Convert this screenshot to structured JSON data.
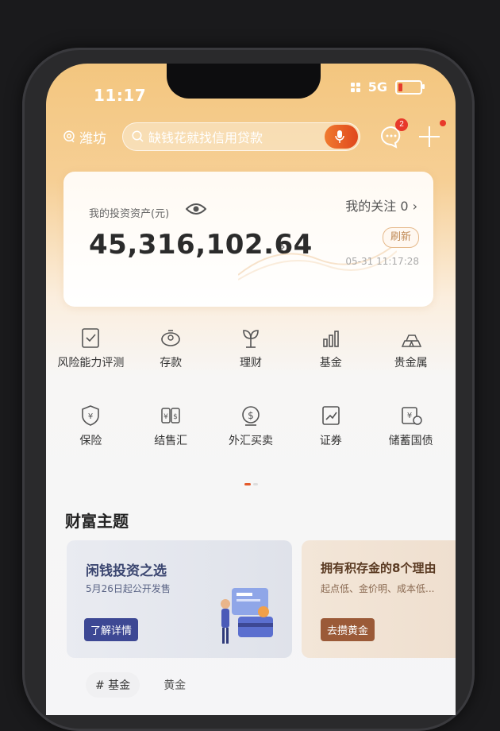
{
  "status": {
    "time": "11:17",
    "network": "5G"
  },
  "topbar": {
    "city": "潍坊",
    "search_placeholder": "缺钱花就找信用贷款",
    "message_badge": "2"
  },
  "asset": {
    "label": "我的投资资产(元)",
    "value": "45,316,102.64",
    "follow": "我的关注 0",
    "refresh": "刷新",
    "timestamp": "05-31 11:17:28"
  },
  "menu": {
    "row1": [
      {
        "label": "风险能力评测",
        "icon": "clipboard-check-icon"
      },
      {
        "label": "存款",
        "icon": "piggy-bank-icon"
      },
      {
        "label": "理财",
        "icon": "money-plant-icon"
      },
      {
        "label": "基金",
        "icon": "bar-chart-icon"
      },
      {
        "label": "贵金属",
        "icon": "gold-bars-icon"
      }
    ],
    "row2": [
      {
        "label": "保险",
        "icon": "shield-yen-icon"
      },
      {
        "label": "结售汇",
        "icon": "exchange-icon"
      },
      {
        "label": "外汇买卖",
        "icon": "currency-coin-icon"
      },
      {
        "label": "证券",
        "icon": "stock-chart-icon"
      },
      {
        "label": "储蓄国债",
        "icon": "bond-certificate-icon"
      }
    ]
  },
  "wealth": {
    "title": "财富主题",
    "card1": {
      "title": "闲钱投资之选",
      "subtitle": "5月26日起公开发售",
      "button": "了解详情"
    },
    "card2": {
      "title": "拥有积存金的8个理由",
      "subtitle": "起点低、金价明、成本低...",
      "button": "去攒黄金"
    },
    "tags": [
      "# 基金",
      "黄金"
    ]
  },
  "colors": {
    "accent": "#e45a2a",
    "brand_orange": "#f3c67f",
    "theme_blue": "#3d4894",
    "theme_brown": "#9b5a38"
  }
}
